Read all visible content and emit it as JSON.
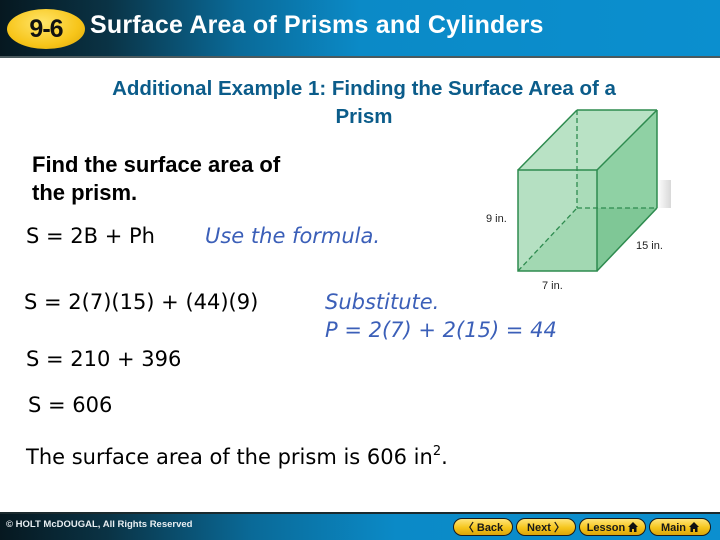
{
  "header": {
    "lesson_badge": "9-6",
    "title": "Surface Area of Prisms and Cylinders"
  },
  "example": {
    "title_line1": "Additional Example 1: Finding the Surface Area of a",
    "title_line2": "Prism",
    "prompt_line1": "Find the surface area of",
    "prompt_line2": "the prism."
  },
  "steps": [
    {
      "equation": "S = 2B + Ph",
      "note": "Use the formula."
    },
    {
      "equation": "S = 2(7)(15) + (44)(9)",
      "note": "Substitute.",
      "note2": "P = 2(7) + 2(15) = 44"
    },
    {
      "equation": "S = 210 + 396"
    },
    {
      "equation": "S = 606"
    }
  ],
  "conclusion": {
    "text": "The surface area of the prism is 606 in",
    "exponent": "2",
    "end": "."
  },
  "figure": {
    "height_label": "9 in.",
    "length_label": "15 in.",
    "width_label": "7 in.",
    "face_color": "#8fd0a2",
    "edge_color": "#2e8b4f"
  },
  "footer": {
    "copyright": "© HOLT McDOUGAL, All Rights Reserved",
    "nav": {
      "back": "Back",
      "next": "Next",
      "lesson": "Lesson",
      "main": "Main"
    }
  }
}
